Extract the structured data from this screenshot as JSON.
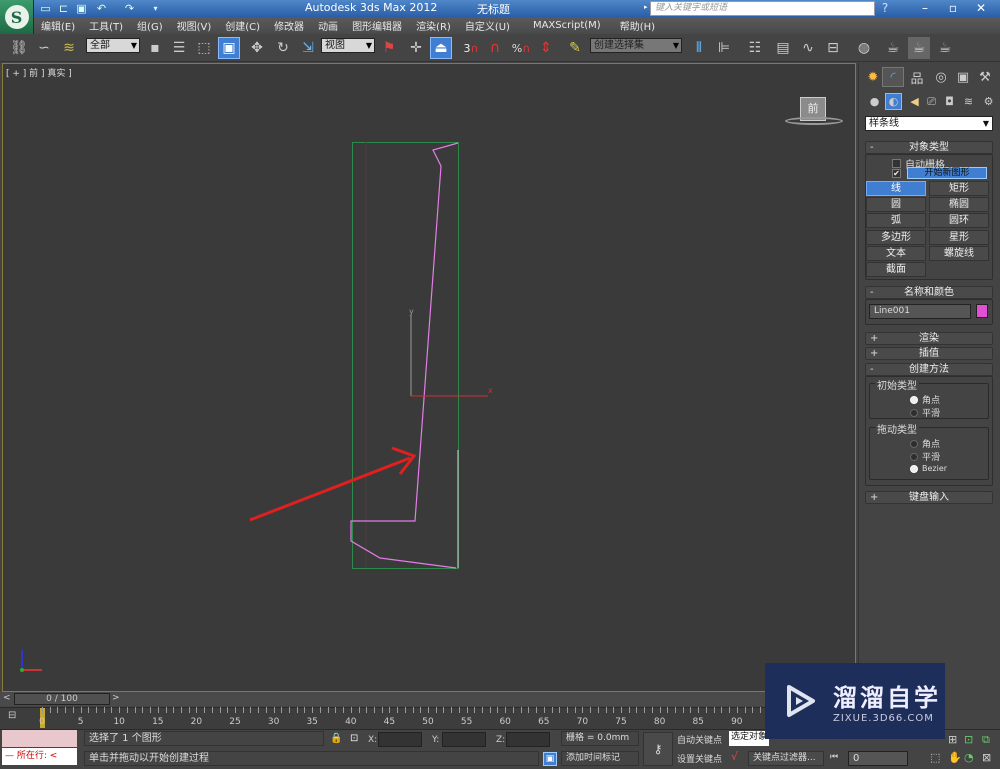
{
  "app": {
    "title": "Autodesk 3ds Max  2012",
    "file_title": "无标题",
    "search_placeholder": "键入关键字或短语"
  },
  "quick_access": [
    "new-file-icon",
    "open-file-icon",
    "save-icon",
    "undo-icon",
    "redo-icon",
    "customize-icon"
  ],
  "menus": [
    "编辑(E)",
    "工具(T)",
    "组(G)",
    "视图(V)",
    "创建(C)",
    "修改器",
    "动画",
    "图形编辑器",
    "渲染(R)",
    "自定义(U)",
    "MAXScript(M)",
    "帮助(H)"
  ],
  "toolbar": {
    "selection_filter": "全部",
    "reference_coord": "视图",
    "named_selection": "创建选择集",
    "snap_label": "3"
  },
  "viewport": {
    "label": "[ + ] 前 ] 真实 ]",
    "viewcube_face": "前",
    "axis_x": "x",
    "axis_y": "y",
    "shape_color": "#e27ee6",
    "bbox_color": "#2e8a4a",
    "annotation_arrow_color": "#e02020"
  },
  "command_panel": {
    "category": "样条线",
    "object_type": {
      "title": "对象类型",
      "autogrid": "自动栅格",
      "start_new_shape": "开始新图形",
      "start_new_shape_checked": true,
      "buttons": [
        "线",
        "矩形",
        "圆",
        "椭圆",
        "弧",
        "圆环",
        "多边形",
        "星形",
        "文本",
        "螺旋线",
        "截面"
      ],
      "active": "线"
    },
    "name_color": {
      "title": "名称和颜色",
      "name": "Line001",
      "color": "#e04fd4"
    },
    "rendering": "渲染",
    "interpolation": "插值",
    "creation_method": {
      "title": "创建方法",
      "initial_type": {
        "title": "初始类型",
        "options": [
          "角点",
          "平滑"
        ],
        "selected": "角点"
      },
      "drag_type": {
        "title": "拖动类型",
        "options": [
          "角点",
          "平滑",
          "Bezier"
        ],
        "selected": "Bezier"
      }
    },
    "keyboard_entry": "键盘输入"
  },
  "timeline": {
    "slider": "0 / 100",
    "ticks": [
      "0",
      "5",
      "10",
      "15",
      "20",
      "25",
      "30",
      "35",
      "40",
      "45",
      "50",
      "55",
      "60",
      "65",
      "70",
      "75",
      "80",
      "85",
      "90"
    ]
  },
  "status": {
    "maxscript_line": "所在行:",
    "selection": "选择了 1 个图形",
    "prompt": "单击并拖动以开始创建过程",
    "x_label": "X:",
    "y_label": "Y:",
    "z_label": "Z:",
    "grid": "栅格 = 0.0mm",
    "add_time_tag": "添加时间标记",
    "auto_key": "自动关键点",
    "selected": "选定对象",
    "set_key": "设置关键点",
    "key_filters": "关键点过滤器...",
    "frame": "0"
  },
  "watermark": {
    "title": "溜溜自学",
    "url": "ZIXUE.3D66.COM"
  }
}
